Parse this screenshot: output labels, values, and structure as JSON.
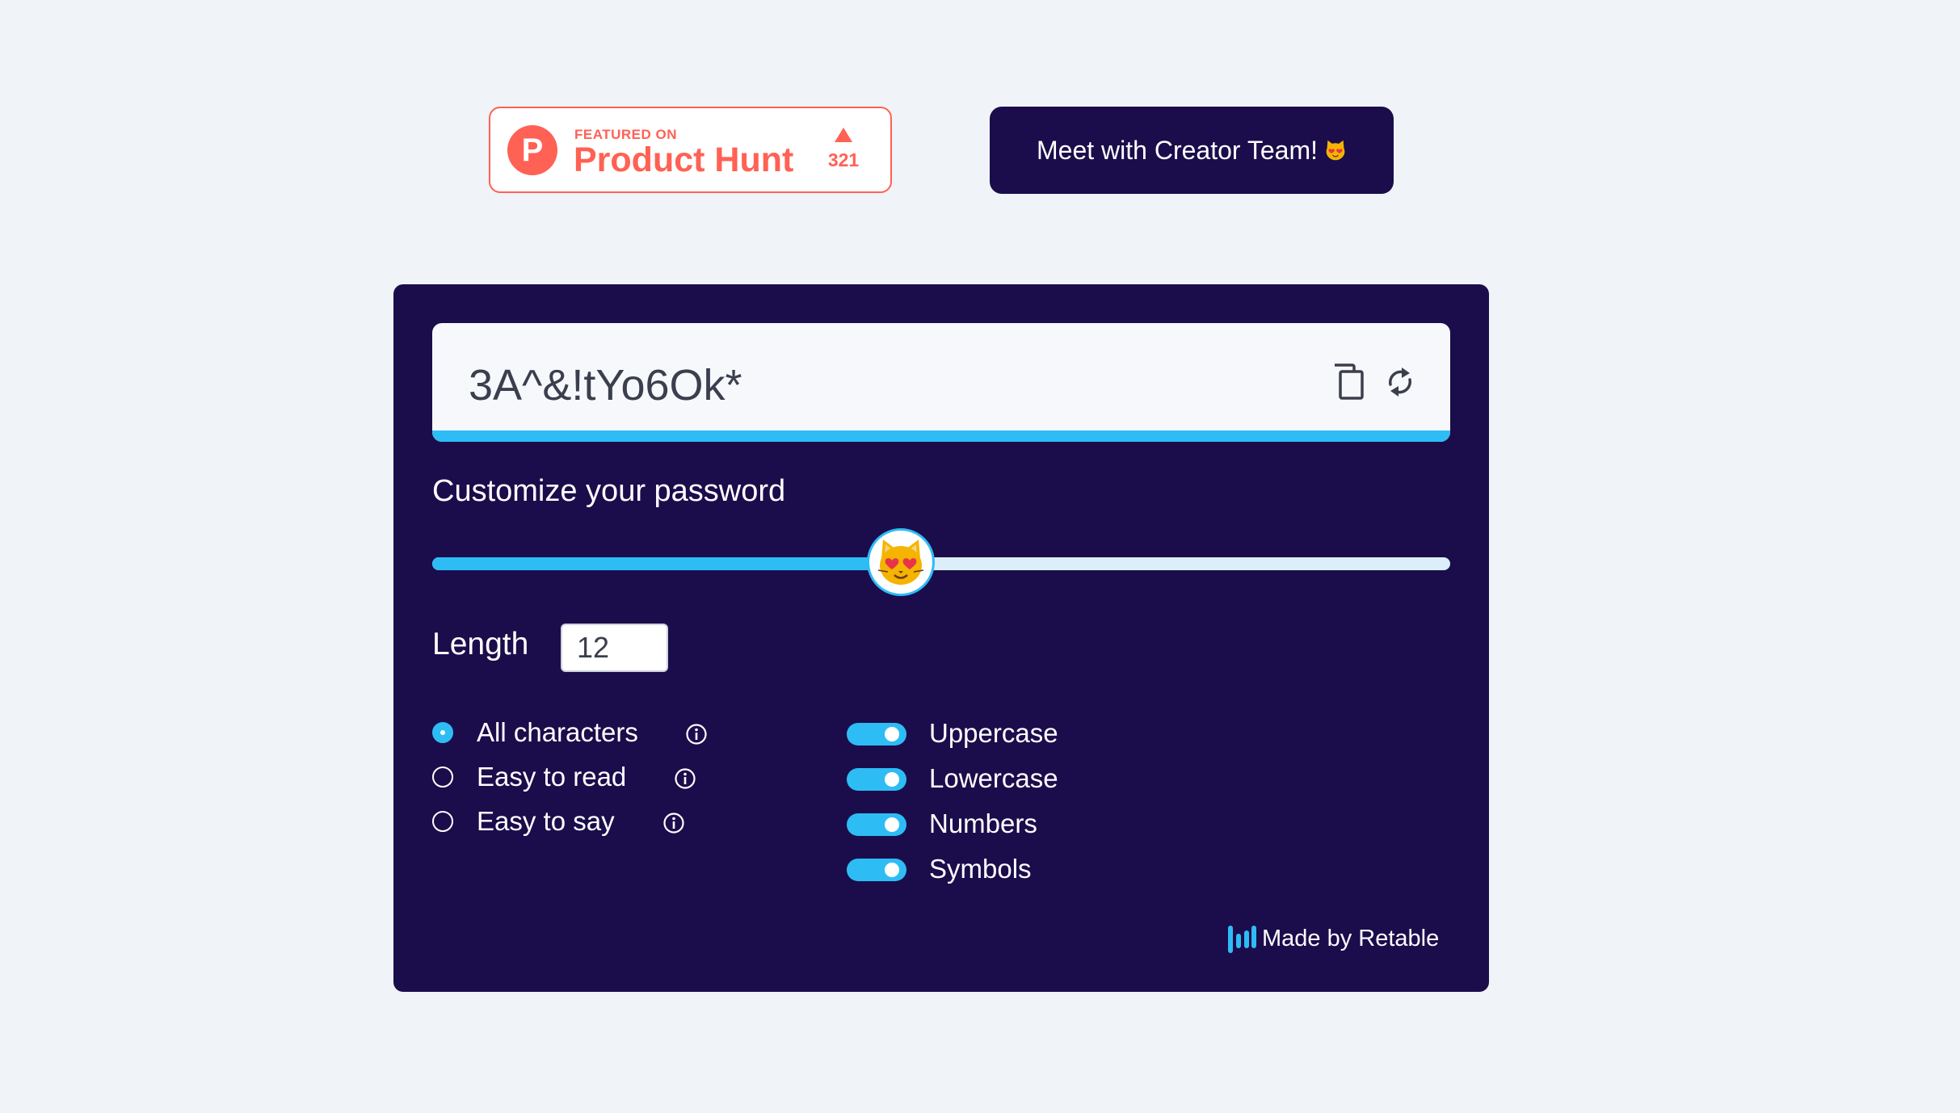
{
  "product_hunt": {
    "featured_label": "FEATURED ON",
    "logo_letter": "P",
    "name": "Product Hunt",
    "votes": "321"
  },
  "meet_button": {
    "label": "Meet with Creator Team!",
    "emoji_icon": "heart-eyes-cat-icon"
  },
  "generator": {
    "password": "3A^&!tYo6Ok*",
    "strength_fraction": 1.0,
    "copy_icon": "copy-icon",
    "refresh_icon": "refresh-icon",
    "customize_title": "Customize your password",
    "slider": {
      "value_fraction": 0.46,
      "thumb_icon": "heart-eyes-cat-icon"
    },
    "length_label": "Length",
    "length_value": "12",
    "modes": [
      {
        "label": "All characters",
        "checked": true
      },
      {
        "label": "Easy to read",
        "checked": false
      },
      {
        "label": "Easy to say",
        "checked": false
      }
    ],
    "options": [
      {
        "label": "Uppercase",
        "on": true
      },
      {
        "label": "Lowercase",
        "on": true
      },
      {
        "label": "Numbers",
        "on": true
      },
      {
        "label": "Symbols",
        "on": true
      }
    ],
    "made_by": "Made by Retable"
  },
  "colors": {
    "page_bg": "#f0f3f7",
    "card_bg": "#1b0d4b",
    "accent": "#2ebcf5",
    "product_hunt": "#ff6154"
  }
}
